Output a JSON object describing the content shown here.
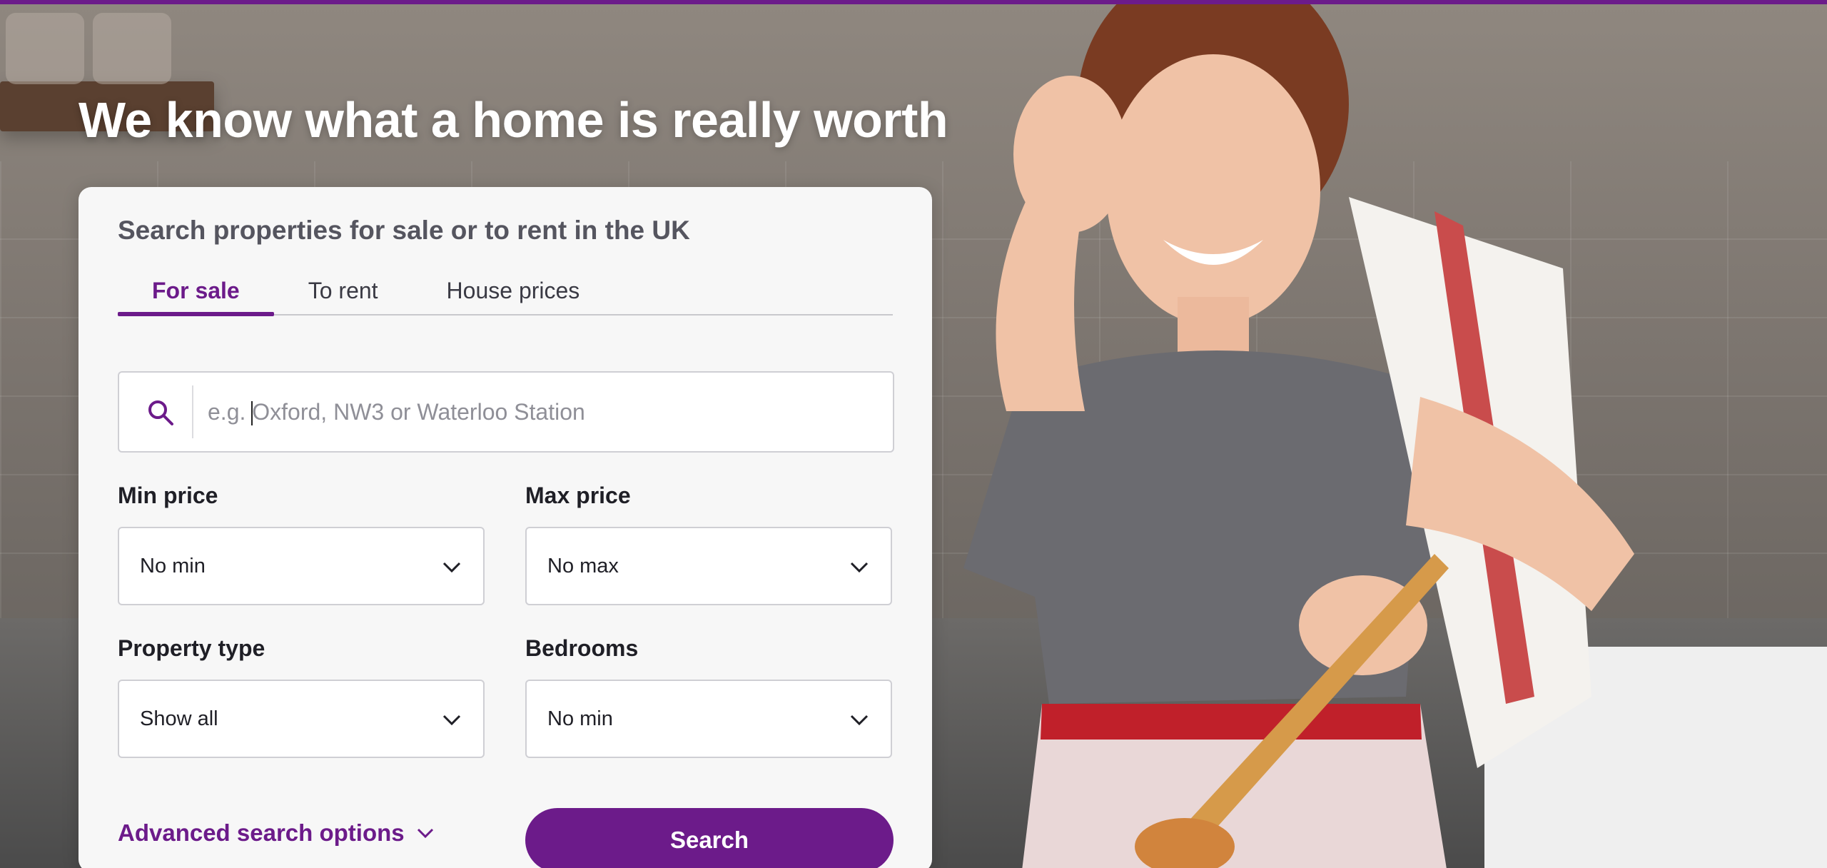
{
  "brand": {
    "accent_color": "#6c1b8a"
  },
  "hero": {
    "headline": "We know what a home is really worth",
    "image": "hero-photo-woman-cooking-in-kitchen"
  },
  "search_card": {
    "title": "Search properties for sale or to rent in the UK",
    "tabs": [
      {
        "label": "For sale",
        "active": true
      },
      {
        "label": "To rent",
        "active": false
      },
      {
        "label": "House prices",
        "active": false
      }
    ],
    "location": {
      "placeholder": "e.g. Oxford, NW3 or Waterloo Station",
      "value": "",
      "icon": "search-icon"
    },
    "filters": {
      "min_price": {
        "label": "Min price",
        "value": "No min"
      },
      "max_price": {
        "label": "Max price",
        "value": "No max"
      },
      "property_type": {
        "label": "Property type",
        "value": "Show all"
      },
      "bedrooms": {
        "label": "Bedrooms",
        "value": "No min"
      }
    },
    "advanced_label": "Advanced search options",
    "search_button_label": "Search"
  }
}
